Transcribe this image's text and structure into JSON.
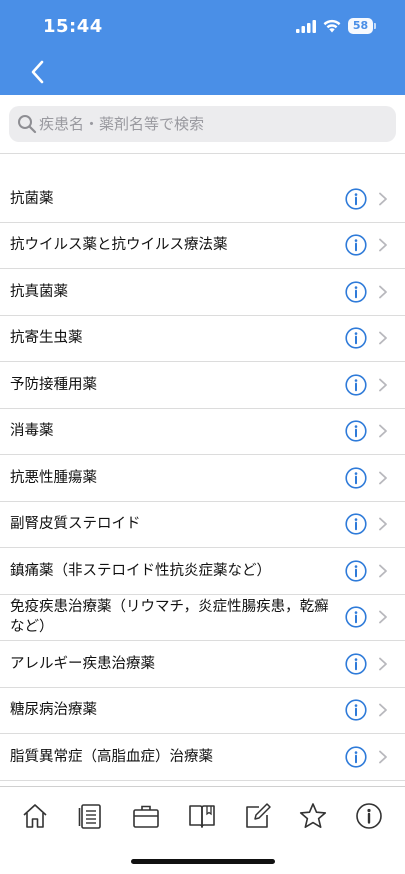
{
  "status_bar": {
    "time": "15:44",
    "battery": "58",
    "icons": [
      "signal-icon",
      "wifi-icon",
      "battery-icon"
    ]
  },
  "nav": {
    "back_icon": "chevron-left-icon"
  },
  "search": {
    "placeholder": "疾患名・薬剤名等で検索",
    "value": "",
    "icon": "search-icon"
  },
  "categories": [
    {
      "label": "抗菌薬"
    },
    {
      "label": "抗ウイルス薬と抗ウイルス療法薬"
    },
    {
      "label": "抗真菌薬"
    },
    {
      "label": "抗寄生虫薬"
    },
    {
      "label": "予防接種用薬"
    },
    {
      "label": "消毒薬"
    },
    {
      "label": "抗悪性腫瘍薬"
    },
    {
      "label": "副腎皮質ステロイド"
    },
    {
      "label": "鎮痛薬（非ステロイド性抗炎症薬など）"
    },
    {
      "label": "免疫疾患治療薬（リウマチ，炎症性腸疾患，乾癬など）"
    },
    {
      "label": "アレルギー疾患治療薬"
    },
    {
      "label": "糖尿病治療薬"
    },
    {
      "label": "脂質異常症（高脂血症）治療薬"
    }
  ],
  "row_icons": {
    "info": "info-icon",
    "chevron": "chevron-right-icon"
  },
  "tabbar": [
    {
      "name": "home",
      "icon": "home-icon"
    },
    {
      "name": "document",
      "icon": "document-icon"
    },
    {
      "name": "briefcase",
      "icon": "briefcase-icon"
    },
    {
      "name": "book",
      "icon": "book-icon"
    },
    {
      "name": "edit",
      "icon": "edit-icon"
    },
    {
      "name": "favorites",
      "icon": "star-icon"
    },
    {
      "name": "info",
      "icon": "info-icon"
    }
  ],
  "colors": {
    "header": "#4a8fe7",
    "info_icon": "#2f7bd9",
    "chevron": "#b8b8bd",
    "tab_icon": "#333333"
  }
}
